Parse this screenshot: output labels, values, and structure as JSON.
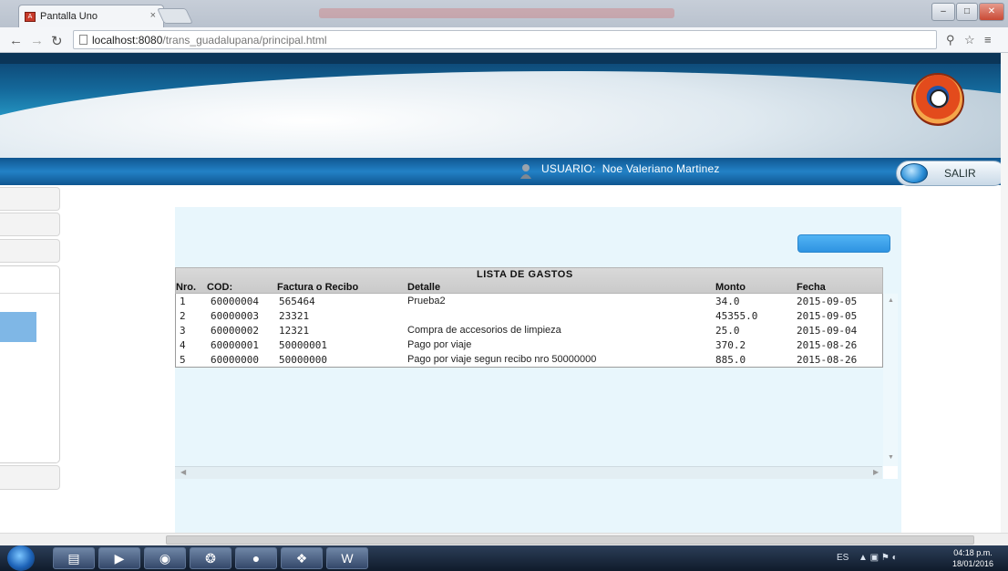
{
  "browser": {
    "tab_title": "Pantalla Uno",
    "tab_close": "×",
    "url_host": "localhost:8080",
    "url_path": "/trans_guadalupana/principal.html",
    "window_buttons": [
      "–",
      "□",
      "✕"
    ]
  },
  "header": {
    "user_label": "USUARIO:",
    "user_name": "Noe Valeriano Martinez",
    "logout_label": "SALIR"
  },
  "expenses": {
    "title": "LISTA DE GASTOS",
    "columns": [
      "Nro.",
      "COD:",
      "Factura o Recibo",
      "Detalle",
      "Monto",
      "Fecha"
    ],
    "rows": [
      {
        "nro": "1",
        "cod": "60000004",
        "factura": "565464",
        "detalle": "Prueba2",
        "monto": "34.0",
        "fecha": "2015-09-05"
      },
      {
        "nro": "2",
        "cod": "60000003",
        "factura": "23321",
        "detalle": "",
        "monto": "45355.0",
        "fecha": "2015-09-05"
      },
      {
        "nro": "3",
        "cod": "60000002",
        "factura": "12321",
        "detalle": "Compra de accesorios de limpieza",
        "monto": "25.0",
        "fecha": "2015-09-04"
      },
      {
        "nro": "4",
        "cod": "60000001",
        "factura": "50000001",
        "detalle": "Pago por viaje",
        "monto": "370.2",
        "fecha": "2015-08-26"
      },
      {
        "nro": "5",
        "cod": "60000000",
        "factura": "50000000",
        "detalle": "Pago por viaje segun recibo nro 50000000",
        "monto": "885.0",
        "fecha": "2015-08-26"
      }
    ]
  },
  "taskbar": {
    "tray_lang": "ES",
    "clock_time": "04:18 p.m.",
    "clock_date": "18/01/2016"
  },
  "colors": {
    "accent": "#2e93e2",
    "banner": "#14699b",
    "content_bg": "#e8f6fc"
  }
}
